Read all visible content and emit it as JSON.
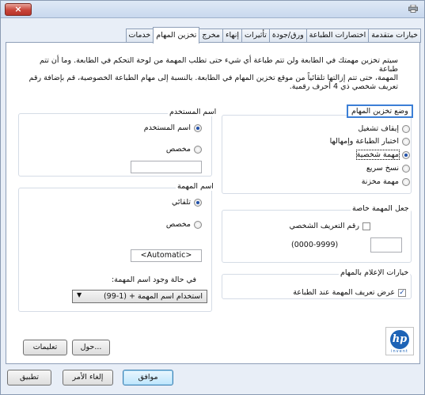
{
  "window": {
    "close_label": "×"
  },
  "tabs": [
    {
      "label": "خيارات متقدمة",
      "active": false
    },
    {
      "label": "اختصارات الطباعة",
      "active": false
    },
    {
      "label": "ورق/جودة",
      "active": false
    },
    {
      "label": "تأثيرات",
      "active": false
    },
    {
      "label": "إنهاء",
      "active": false
    },
    {
      "label": "مخرج",
      "active": false
    },
    {
      "label": "تخزين المهام",
      "active": true
    },
    {
      "label": "خدمات",
      "active": false
    }
  ],
  "description": {
    "line1": "سيتم تخزين مهمتك في الطابعة ولن تتم طباعة أي شيء حتى تطلب المهمة من لوحة التحكم في الطابعة. وما أن تتم طباعة",
    "line2": "المهمة، حتى تتم إزالتها تلقائياً من موقع تخزين المهام في الطابعة. بالنسبة إلى مهام الطباعة الخصوصية، قم بإضافة رقم",
    "line3": "تعريف شخصي ذي 4 أحرف رقمية."
  },
  "job_storage_mode": {
    "title": "وضع تخزين المهام",
    "options": [
      {
        "label": "إيقاف تشغيل",
        "checked": false
      },
      {
        "label": "اختبار الطباعة وإمهالها",
        "checked": false
      },
      {
        "label": "مهمة شخصية",
        "checked": true
      },
      {
        "label": "نسخ سريع",
        "checked": false
      },
      {
        "label": "مهمة مخزنة",
        "checked": false
      }
    ]
  },
  "make_job_private": {
    "title": "جعل المهمة خاصة",
    "pin_label": "رقم التعريف الشخصي",
    "pin_checked": false,
    "pin_range": "(0000-9999)",
    "pin_value": ""
  },
  "notification": {
    "title": "خيارات الإعلام بالمهام",
    "display_job_id_label": "عرض تعريف المهمة عند الطباعة",
    "display_job_id_checked": true
  },
  "user_name": {
    "title": "اسم المستخدم",
    "options": [
      {
        "label": "اسم المستخدم",
        "checked": true
      },
      {
        "label": "مخصص",
        "checked": false
      }
    ],
    "custom_value": ""
  },
  "job_name": {
    "title": "اسم المهمة",
    "options": [
      {
        "label": "تلقائي",
        "checked": true
      },
      {
        "label": "مخصص",
        "checked": false
      }
    ],
    "custom_value": "<Automatic>",
    "exists_label": "في حالة وجود اسم المهمة:",
    "exists_selected": "استخدام اسم المهمة + (1-99)"
  },
  "bottom_buttons": {
    "about": "حول...",
    "help": "تعليمات"
  },
  "logo": {
    "text": "hp",
    "tagline": "invent"
  },
  "dialog_buttons": {
    "ok": "موافق",
    "cancel": "إلغاء الأمر",
    "apply": "تطبيق"
  }
}
